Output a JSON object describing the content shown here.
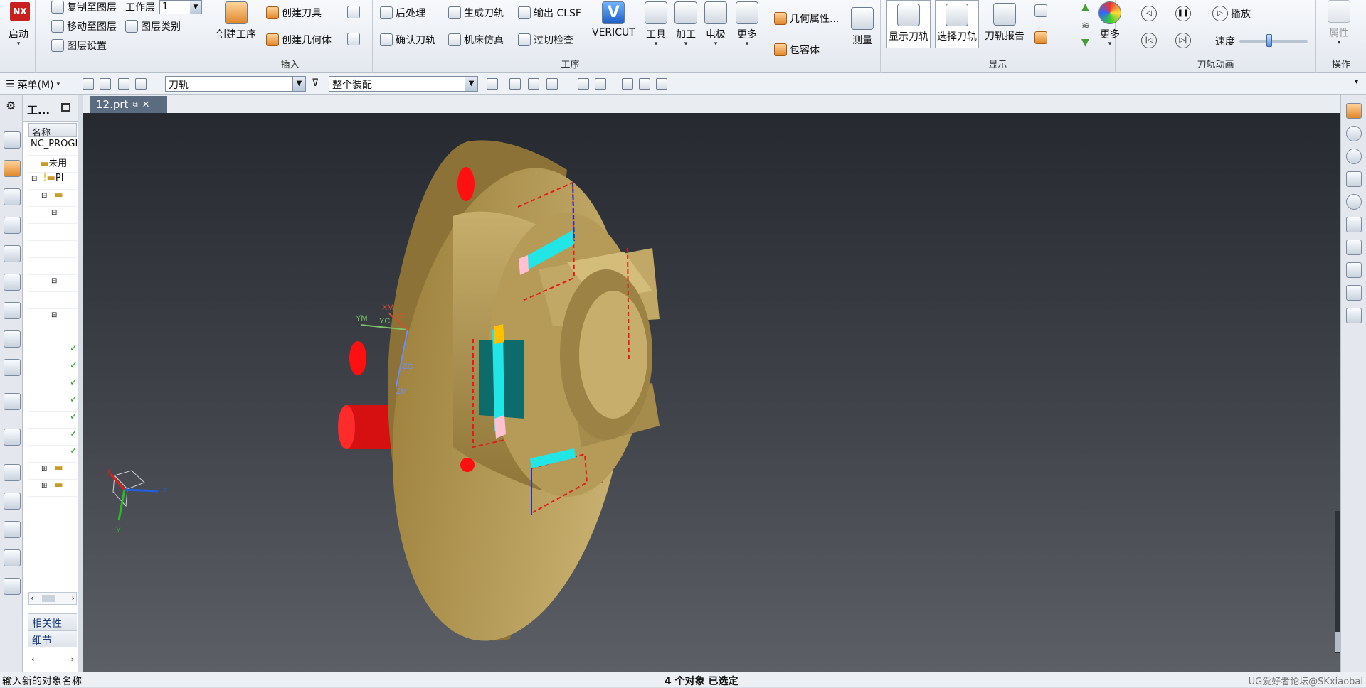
{
  "ribbon": {
    "start": {
      "logo": "NX",
      "label": "启动"
    },
    "layers": {
      "copy": "复制至图层",
      "move": "移动至图层",
      "settings": "图层设置",
      "work_layer_label": "工作层",
      "work_layer_value": "1",
      "category": "图层类别"
    },
    "insert": {
      "create_op": "创建工序",
      "create_tool": "创建刀具",
      "create_geom": "创建几何体",
      "group": "插入"
    },
    "operation": {
      "postprocess": "后处理",
      "generate": "生成刀轨",
      "output_clsf": "输出 CLSF",
      "verify": "确认刀轨",
      "simulate": "机床仿真",
      "overcut": "过切检查",
      "vericut": "VERICUT",
      "tools": "工具",
      "machining": "加工",
      "electrode": "电极",
      "more": "更多",
      "group": "工序"
    },
    "geometry": {
      "props": "几何属性...",
      "envelope": "包容体",
      "measure": "测量"
    },
    "display": {
      "show_path": "显示刀轨",
      "select_path": "选择刀轨",
      "report": "刀轨报告",
      "more": "更多",
      "group": "显示"
    },
    "animation": {
      "play": "播放",
      "speed": "速度",
      "group": "刀轨动画"
    },
    "ops": {
      "attributes": "属性",
      "group": "操作"
    }
  },
  "toolbar2": {
    "menu": "菜单(M)",
    "filter_value": "刀轨",
    "scope_value": "整个装配"
  },
  "nav": {
    "tab_title": "工...",
    "col_name": "名称",
    "root": "NC_PROGRAM",
    "unused": "未用",
    "pi": "PI",
    "related": "相关性",
    "detail": "细节"
  },
  "doc_tab": {
    "title": "12.prt"
  },
  "viewport": {
    "wcs": {
      "xm": "XM",
      "xc": "XC",
      "ym": "YM",
      "yc": "YC",
      "zc": "ZC",
      "zm": "ZM"
    },
    "triad": {
      "x": "X",
      "y": "Y",
      "z": "Z"
    }
  },
  "status": {
    "prompt": "输入新的对象名称",
    "selection": "4 个对象 已选定",
    "watermark": "UG爱好者论坛@SKxiaobai"
  },
  "colors": {
    "part": "#b8a060",
    "highlight": "#ff0000",
    "path_cyan": "#22e6e6",
    "path_blue": "#1f2fd8",
    "path_red": "#e21c1c"
  }
}
